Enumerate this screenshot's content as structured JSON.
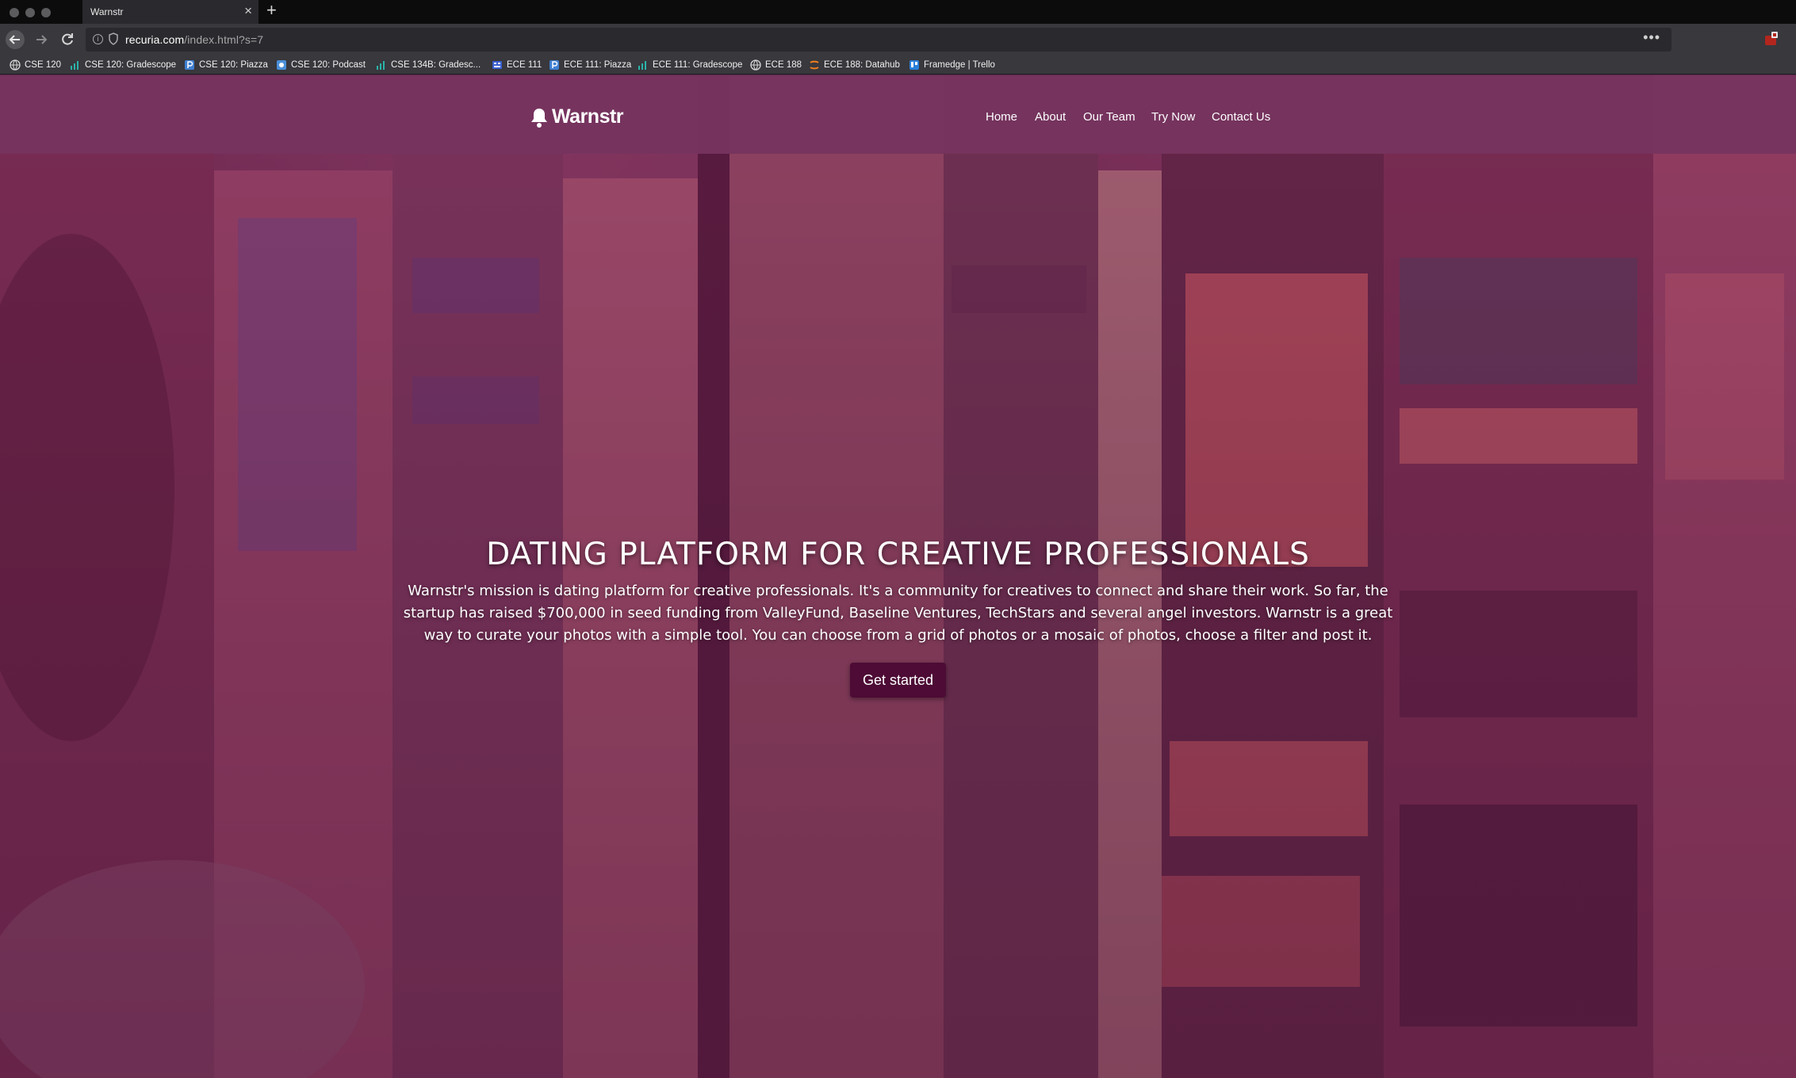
{
  "browser": {
    "tab_title": "Warnstr",
    "tab_close": "×",
    "new_tab": "+",
    "url_host": "recuria.com",
    "url_path": "/index.html?s=7",
    "menu_dots": "•••",
    "bookmarks": [
      {
        "label": "CSE 120",
        "icon": "globe-icon",
        "color": "#d8d8d8"
      },
      {
        "label": "CSE 120: Gradescope",
        "icon": "bars-icon",
        "color": "#2bb3a8"
      },
      {
        "label": "CSE 120: Piazza",
        "icon": "piazza-icon",
        "color": "#3f7fd1"
      },
      {
        "label": "CSE 120: Podcast",
        "icon": "podcast-icon",
        "color": "#4a8fd8"
      },
      {
        "label": "CSE 134B: Gradesc...",
        "icon": "bars-icon",
        "color": "#2bb3a8"
      },
      {
        "label": "ECE 111",
        "icon": "canvas-icon",
        "color": "#3a5fd0"
      },
      {
        "label": "ECE 111: Piazza",
        "icon": "piazza-icon",
        "color": "#3f7fd1"
      },
      {
        "label": "ECE 111: Gradescope",
        "icon": "bars-icon",
        "color": "#2bb3a8"
      },
      {
        "label": "ECE 188",
        "icon": "globe-icon",
        "color": "#d8d8d8"
      },
      {
        "label": "ECE 188: Datahub",
        "icon": "jupyter-icon",
        "color": "#f0801e"
      },
      {
        "label": "Framedge | Trello",
        "icon": "trello-icon",
        "color": "#2a7fd8"
      }
    ]
  },
  "site": {
    "brand": "Warnstr",
    "nav": [
      "Home",
      "About",
      "Our Team",
      "Try Now",
      "Contact Us"
    ],
    "hero_title": "DATING PLATFORM FOR CREATIVE PROFESSIONALS",
    "hero_text": "Warnstr's mission is dating platform for creative professionals. It's a community for creatives to connect and share their work. So far, the startup has raised $700,000 in seed funding from ValleyFund, Baseline Ventures, TechStars and several angel investors. Warnstr is a great way to curate your photos with a simple tool. You can choose from a grid of photos or a mosaic of photos, choose a filter and post it.",
    "cta": "Get started"
  },
  "colors": {
    "header": "#76345e",
    "cta": "#4d0b35",
    "overlay": "#78285a"
  }
}
